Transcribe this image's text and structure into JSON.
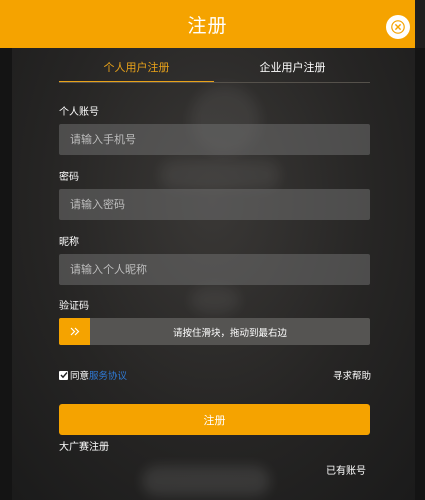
{
  "header": {
    "title": "注册"
  },
  "tabs": [
    {
      "label": "个人用户注册",
      "active": true
    },
    {
      "label": "企业用户注册",
      "active": false
    }
  ],
  "form": {
    "account": {
      "label": "个人账号",
      "placeholder": "请输入手机号",
      "value": ""
    },
    "password": {
      "label": "密码",
      "placeholder": "请输入密码",
      "value": ""
    },
    "nickname": {
      "label": "昵称",
      "placeholder": "请输入个人昵称",
      "value": ""
    },
    "captcha": {
      "label": "验证码",
      "slider_text": "请按住滑块，拖动到最右边",
      "handle_icon": "double-chevron-right-icon"
    }
  },
  "agreement": {
    "checked": true,
    "prefix": "同意",
    "link": "服务协议"
  },
  "help_label": "寻求帮助",
  "submit_label": "注册",
  "contest_link": "大广赛注册",
  "login_link": "已有账号",
  "colors": {
    "accent": "#f5a300",
    "link": "#2f7ad6"
  }
}
